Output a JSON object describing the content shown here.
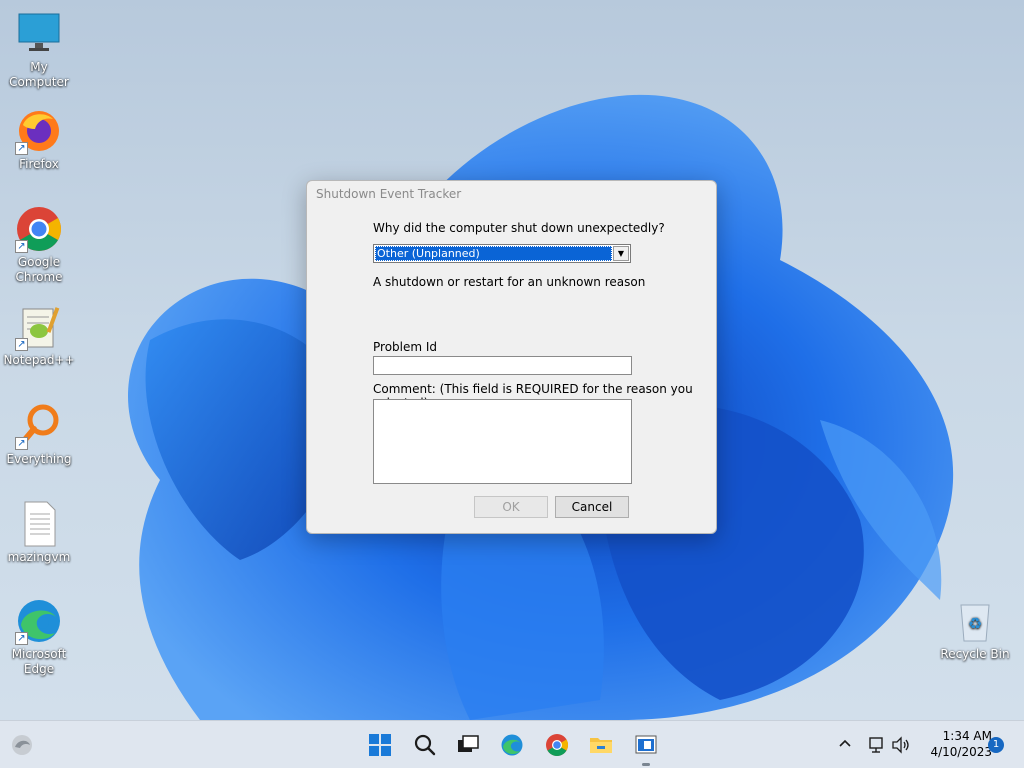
{
  "desktop": {
    "icons": [
      {
        "label": "My Computer"
      },
      {
        "label": "Firefox"
      },
      {
        "label": "Google Chrome"
      },
      {
        "label": "Notepad++"
      },
      {
        "label": "Everything"
      },
      {
        "label": "mazingvm"
      },
      {
        "label": "Microsoft Edge"
      },
      {
        "label": "Recycle Bin"
      }
    ]
  },
  "dialog": {
    "title": "Shutdown Event Tracker",
    "question": "Why did the computer shut down unexpectedly?",
    "reason_selected": "Other (Unplanned)",
    "reason_description": "A shutdown or restart for an unknown reason",
    "problem_id_label": "Problem Id",
    "problem_id_value": "",
    "comment_label": "Comment: (This field is REQUIRED for the reason you selected)",
    "comment_value": "",
    "ok_label": "OK",
    "cancel_label": "Cancel"
  },
  "taskbar": {
    "time": "1:34 AM",
    "date": "4/10/2023",
    "notification_count": "1",
    "apps": [
      "start-icon",
      "search-icon",
      "task-view-icon",
      "edge-icon",
      "chrome-icon",
      "file-explorer-icon",
      "active-window-icon"
    ]
  },
  "colors": {
    "accent": "#0a64d6",
    "wallpaper_bloom": "#1a5fd8",
    "taskbar": "#dfe6ef"
  }
}
